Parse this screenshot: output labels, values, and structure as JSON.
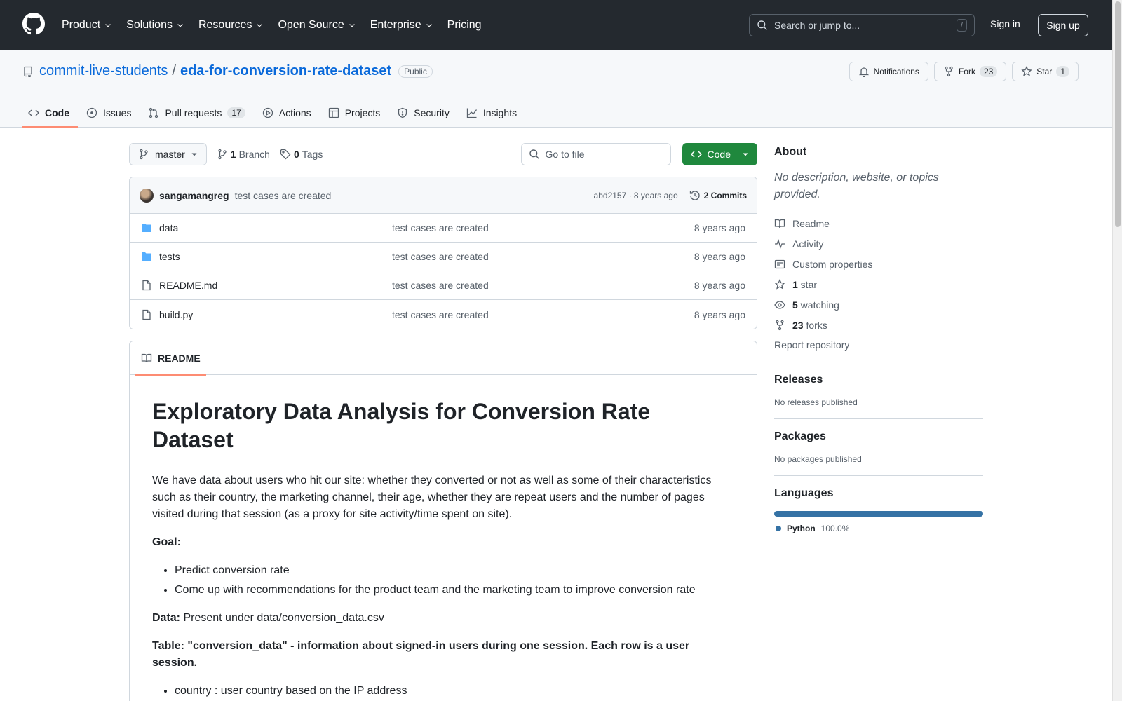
{
  "header": {
    "nav": [
      "Product",
      "Solutions",
      "Resources",
      "Open Source",
      "Enterprise",
      "Pricing"
    ],
    "search_placeholder": "Search or jump to...",
    "search_shortcut": "/",
    "signin": "Sign in",
    "signup": "Sign up"
  },
  "repo": {
    "owner": "commit-live-students",
    "separator": "/",
    "name": "eda-for-conversion-rate-dataset",
    "visibility": "Public",
    "notifications": "Notifications",
    "fork_label": "Fork",
    "fork_count": "23",
    "star_label": "Star",
    "star_count": "1"
  },
  "tabs": [
    {
      "label": "Code",
      "icon": "code-icon",
      "active": true
    },
    {
      "label": "Issues",
      "icon": "issue-icon"
    },
    {
      "label": "Pull requests",
      "icon": "pull-request-icon",
      "count": "17"
    },
    {
      "label": "Actions",
      "icon": "play-icon"
    },
    {
      "label": "Projects",
      "icon": "table-icon"
    },
    {
      "label": "Security",
      "icon": "shield-icon"
    },
    {
      "label": "Insights",
      "icon": "graph-icon"
    }
  ],
  "toolbar": {
    "branch": "master",
    "branches_count": "1",
    "branches_label": "Branch",
    "tags_count": "0",
    "tags_label": "Tags",
    "goto_placeholder": "Go to file",
    "code_button": "Code"
  },
  "commit": {
    "author": "sangamangreg",
    "message": "test cases are created",
    "sha_time": "abd2157 · 8 years ago",
    "commits": "2 Commits"
  },
  "files": [
    {
      "type": "folder",
      "name": "data",
      "message": "test cases are created",
      "date": "8 years ago"
    },
    {
      "type": "folder",
      "name": "tests",
      "message": "test cases are created",
      "date": "8 years ago"
    },
    {
      "type": "file",
      "name": "README.md",
      "message": "test cases are created",
      "date": "8 years ago"
    },
    {
      "type": "file",
      "name": "build.py",
      "message": "test cases are created",
      "date": "8 years ago"
    }
  ],
  "readme": {
    "tab": "README",
    "title": "Exploratory Data Analysis for Conversion Rate Dataset",
    "intro": "We have data about users who hit our site: whether they converted or not as well as some of their characteristics such as their country, the marketing channel, their age, whether they are repeat users and the number of pages visited during that session (as a proxy for site activity/time spent on site).",
    "goal_label": "Goal:",
    "goals": [
      "Predict conversion rate",
      "Come up with recommendations for the product team and the marketing team to improve conversion rate"
    ],
    "data_label": "Data:",
    "data_text": " Present under data/conversion_data.csv",
    "table_heading": "Table: \"conversion_data\" - information about signed-in users during one session. Each row is a user session.",
    "columns": [
      "country : user country based on the IP address"
    ]
  },
  "sidebar": {
    "about_title": "About",
    "about_desc": "No description, website, or topics provided.",
    "links": [
      {
        "icon": "book-icon",
        "label": "Readme"
      },
      {
        "icon": "pulse-icon",
        "label": "Activity"
      },
      {
        "icon": "note-icon",
        "label": "Custom properties"
      },
      {
        "icon": "star-icon",
        "count": "1",
        "label": " star"
      },
      {
        "icon": "eye-icon",
        "count": "5",
        "label": " watching"
      },
      {
        "icon": "fork-icon",
        "count": "23",
        "label": " forks"
      }
    ],
    "report": "Report repository",
    "releases_title": "Releases",
    "releases_text": "No releases published",
    "packages_title": "Packages",
    "packages_text": "No packages published",
    "languages_title": "Languages",
    "language_name": "Python",
    "language_pct": "100.0%",
    "language_color": "#3572A5"
  }
}
